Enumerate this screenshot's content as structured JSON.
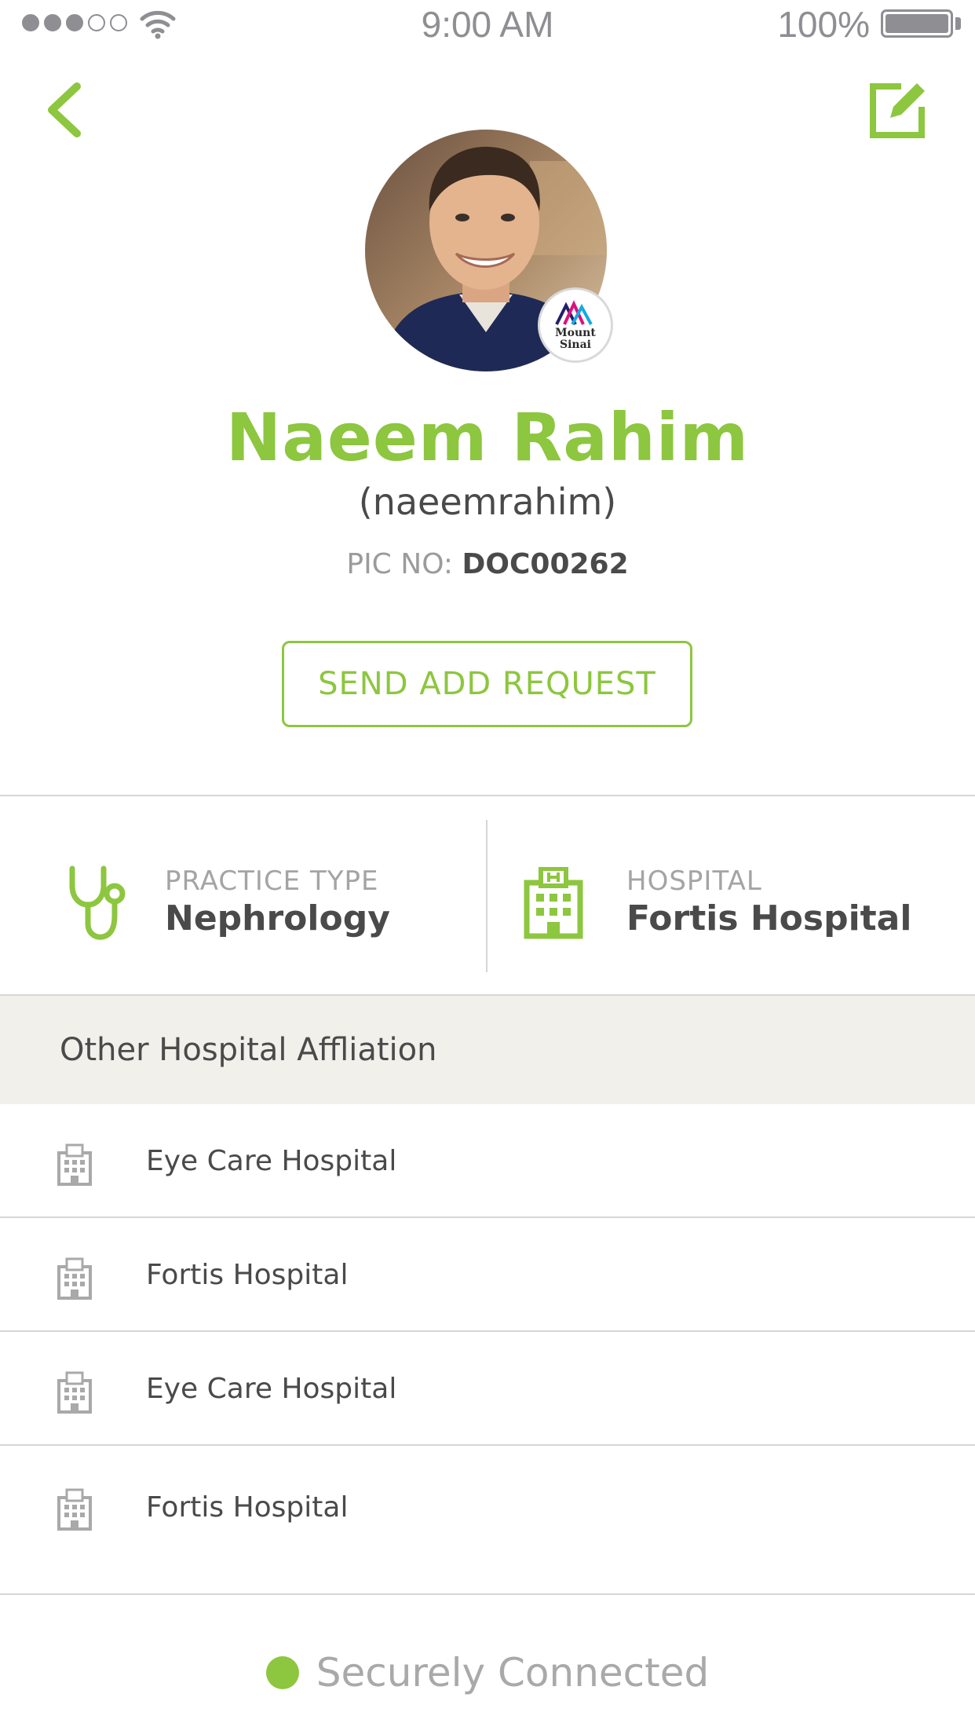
{
  "status_bar": {
    "time": "9:00 AM",
    "battery": "100%",
    "signal_filled": 3,
    "signal_total": 5
  },
  "header": {
    "back_icon": "chevron-left-icon",
    "edit_icon": "edit-icon"
  },
  "profile": {
    "name": "Naeem Rahim",
    "username": "(naeemrahim)",
    "pic_label": "PIC NO:",
    "pic_value": "DOC00262",
    "badge_text": "Mount\nSinai"
  },
  "actions": {
    "send_request": "SEND ADD REQUEST"
  },
  "info": {
    "practice_label": "PRACTICE TYPE",
    "practice_value": "Nephrology",
    "hospital_label": "HOSPITAL",
    "hospital_value": "Fortis Hospital"
  },
  "affiliations": {
    "title": "Other Hospital Affliation",
    "items": [
      {
        "label": "Eye Care Hospital"
      },
      {
        "label": "Fortis Hospital"
      },
      {
        "label": "Eye Care Hospital"
      },
      {
        "label": "Fortis Hospital"
      }
    ]
  },
  "footer": {
    "connection_status": "Securely Connected"
  },
  "colors": {
    "accent": "#8dc63f",
    "text": "#4a4a4a",
    "muted": "#9b9b9b",
    "section_bg": "#f2f0eb"
  }
}
